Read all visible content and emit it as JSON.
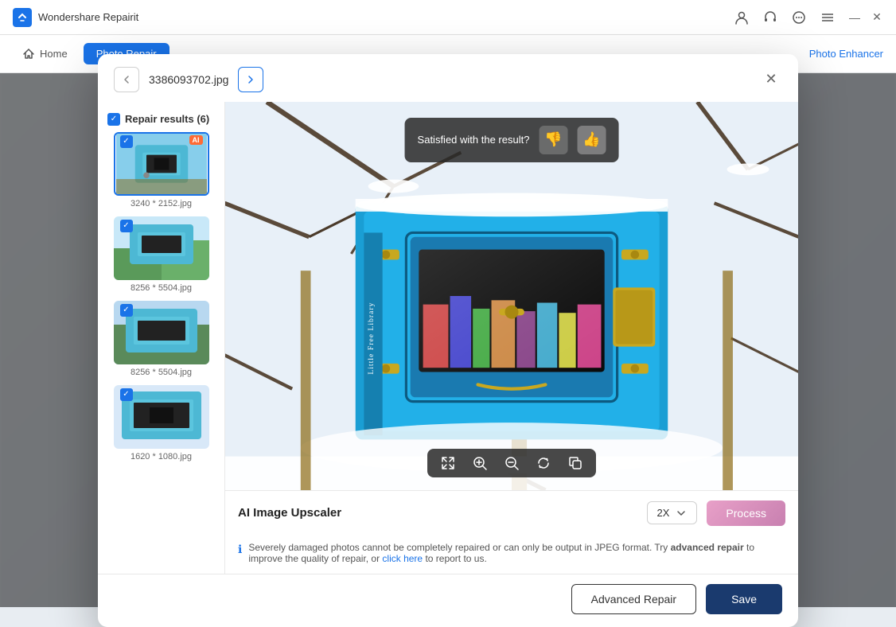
{
  "app": {
    "title": "Wondershare Repairit",
    "logo_text": "W"
  },
  "titlebar": {
    "icons": [
      "account-icon",
      "headset-icon",
      "chat-icon",
      "menu-icon"
    ],
    "minimize": "—",
    "close": "✕"
  },
  "navbar": {
    "home_label": "Home",
    "active_tab": "Photo Repair",
    "photo_enhancer": "Photo Enhancer"
  },
  "modal": {
    "filename": "3386093702.jpg",
    "close_label": "✕",
    "results_header": "Repair results (6)",
    "thumbnails": [
      {
        "size": "3240 * 2152.jpg",
        "selected": true,
        "ai": true
      },
      {
        "size": "8256 * 5504.jpg",
        "selected": false,
        "ai": false
      },
      {
        "size": "8256 * 5504.jpg",
        "selected": false,
        "ai": false
      },
      {
        "size": "1620 * 1080.jpg",
        "selected": false,
        "ai": false
      }
    ],
    "satisfaction": {
      "text": "Satisfied with the result?"
    },
    "toolbar_icons": [
      "expand-icon",
      "zoom-in-icon",
      "zoom-out-icon",
      "rotate-icon",
      "copy-icon"
    ],
    "upscaler": {
      "label": "AI Image Upscaler",
      "scale": "2X",
      "process_label": "Process"
    },
    "info_text_pre": "Severely damaged photos cannot be completely repaired or can only be output in JPEG format. Try ",
    "info_bold": "advanced repair",
    "info_text_mid": " to improve the quality of repair, or ",
    "info_link": "click here",
    "info_text_post": " to report to us.",
    "advanced_repair_label": "Advanced Repair",
    "save_label": "Save"
  },
  "colors": {
    "primary": "#1a73e8",
    "dark_navy": "#1a3a6e",
    "process_gradient_start": "#e8a0c8",
    "process_gradient_end": "#c880b0"
  }
}
